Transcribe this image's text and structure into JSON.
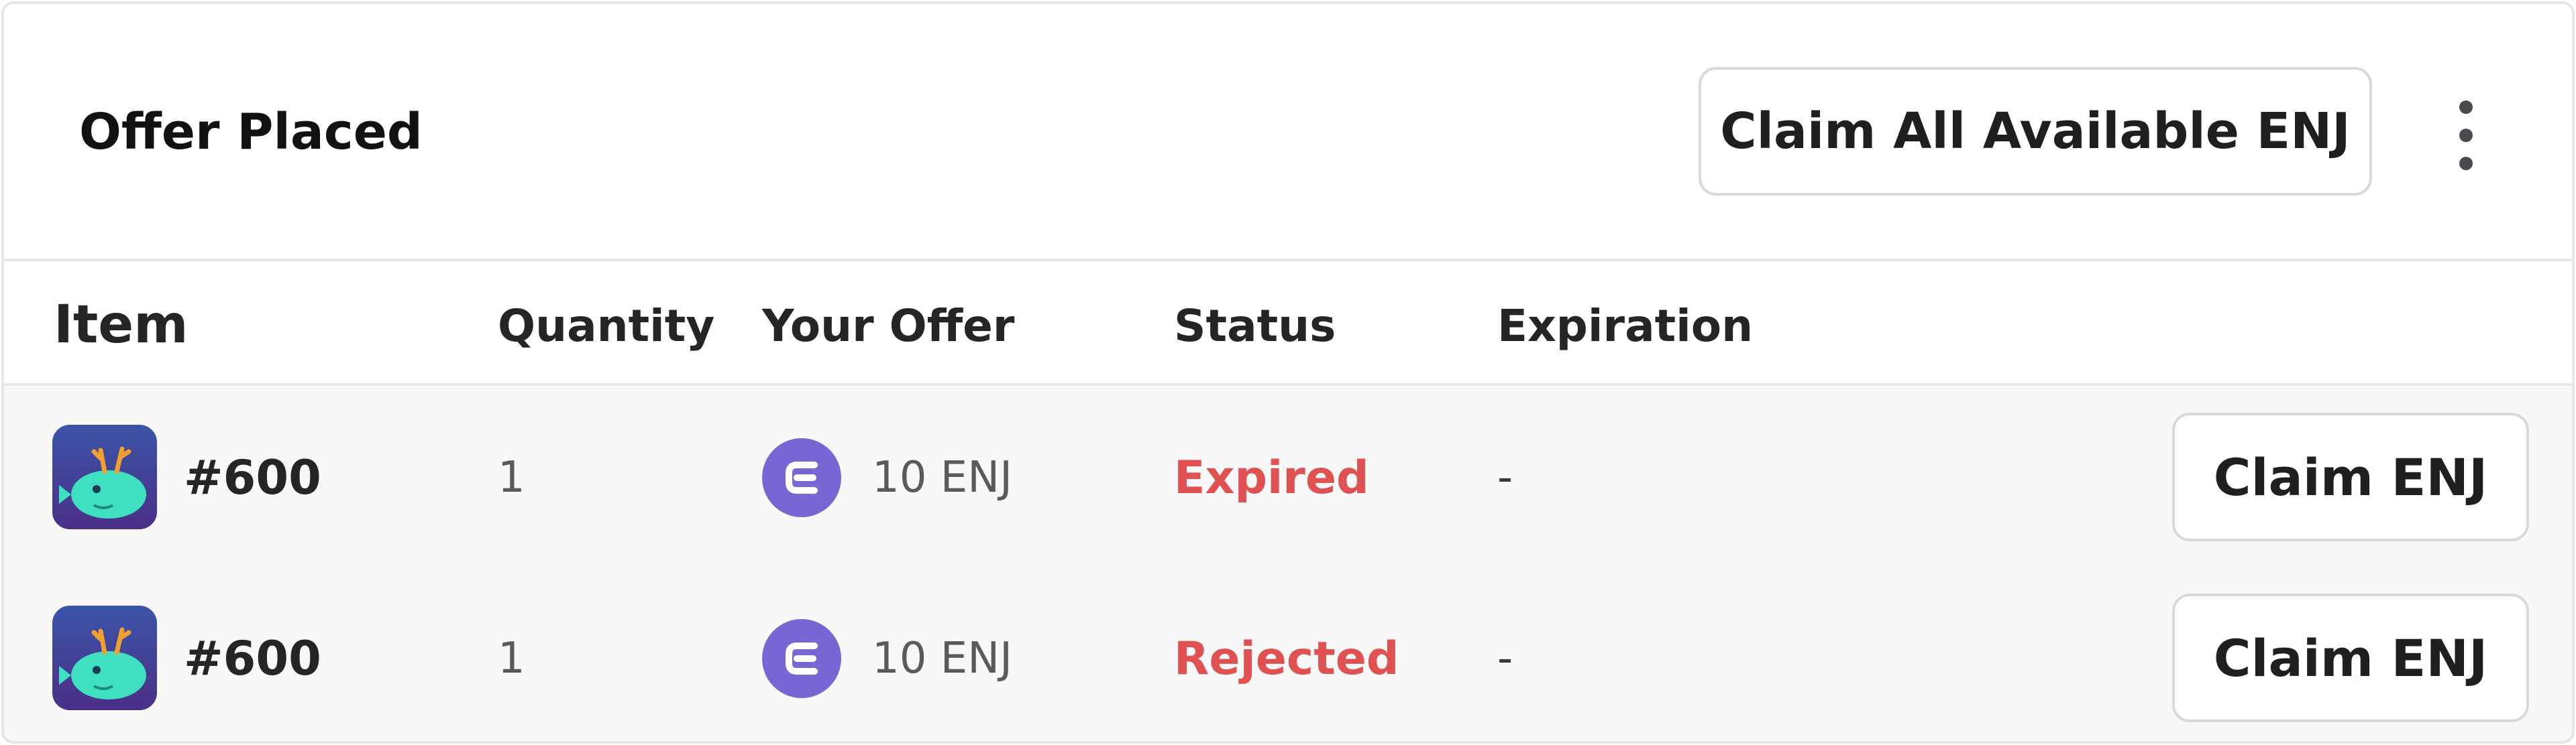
{
  "header": {
    "title": "Offer Placed",
    "claim_all_label": "Claim All Available ENJ",
    "menu_icon": "more-vertical-icon"
  },
  "table": {
    "columns": [
      "Item",
      "Quantity",
      "Your Offer",
      "Status",
      "Expiration"
    ],
    "rows": [
      {
        "item": "#600",
        "quantity": "1",
        "offer": "10 ENJ",
        "status": "Expired",
        "expiration": "-",
        "action_label": "Claim ENJ"
      },
      {
        "item": "#600",
        "quantity": "1",
        "offer": "10 ENJ",
        "status": "Rejected",
        "expiration": "-",
        "action_label": "Claim ENJ"
      }
    ]
  },
  "colors": {
    "status_red": "#e05252",
    "enj_purple": "#7866d5",
    "row_background": "#f8f8f8"
  }
}
